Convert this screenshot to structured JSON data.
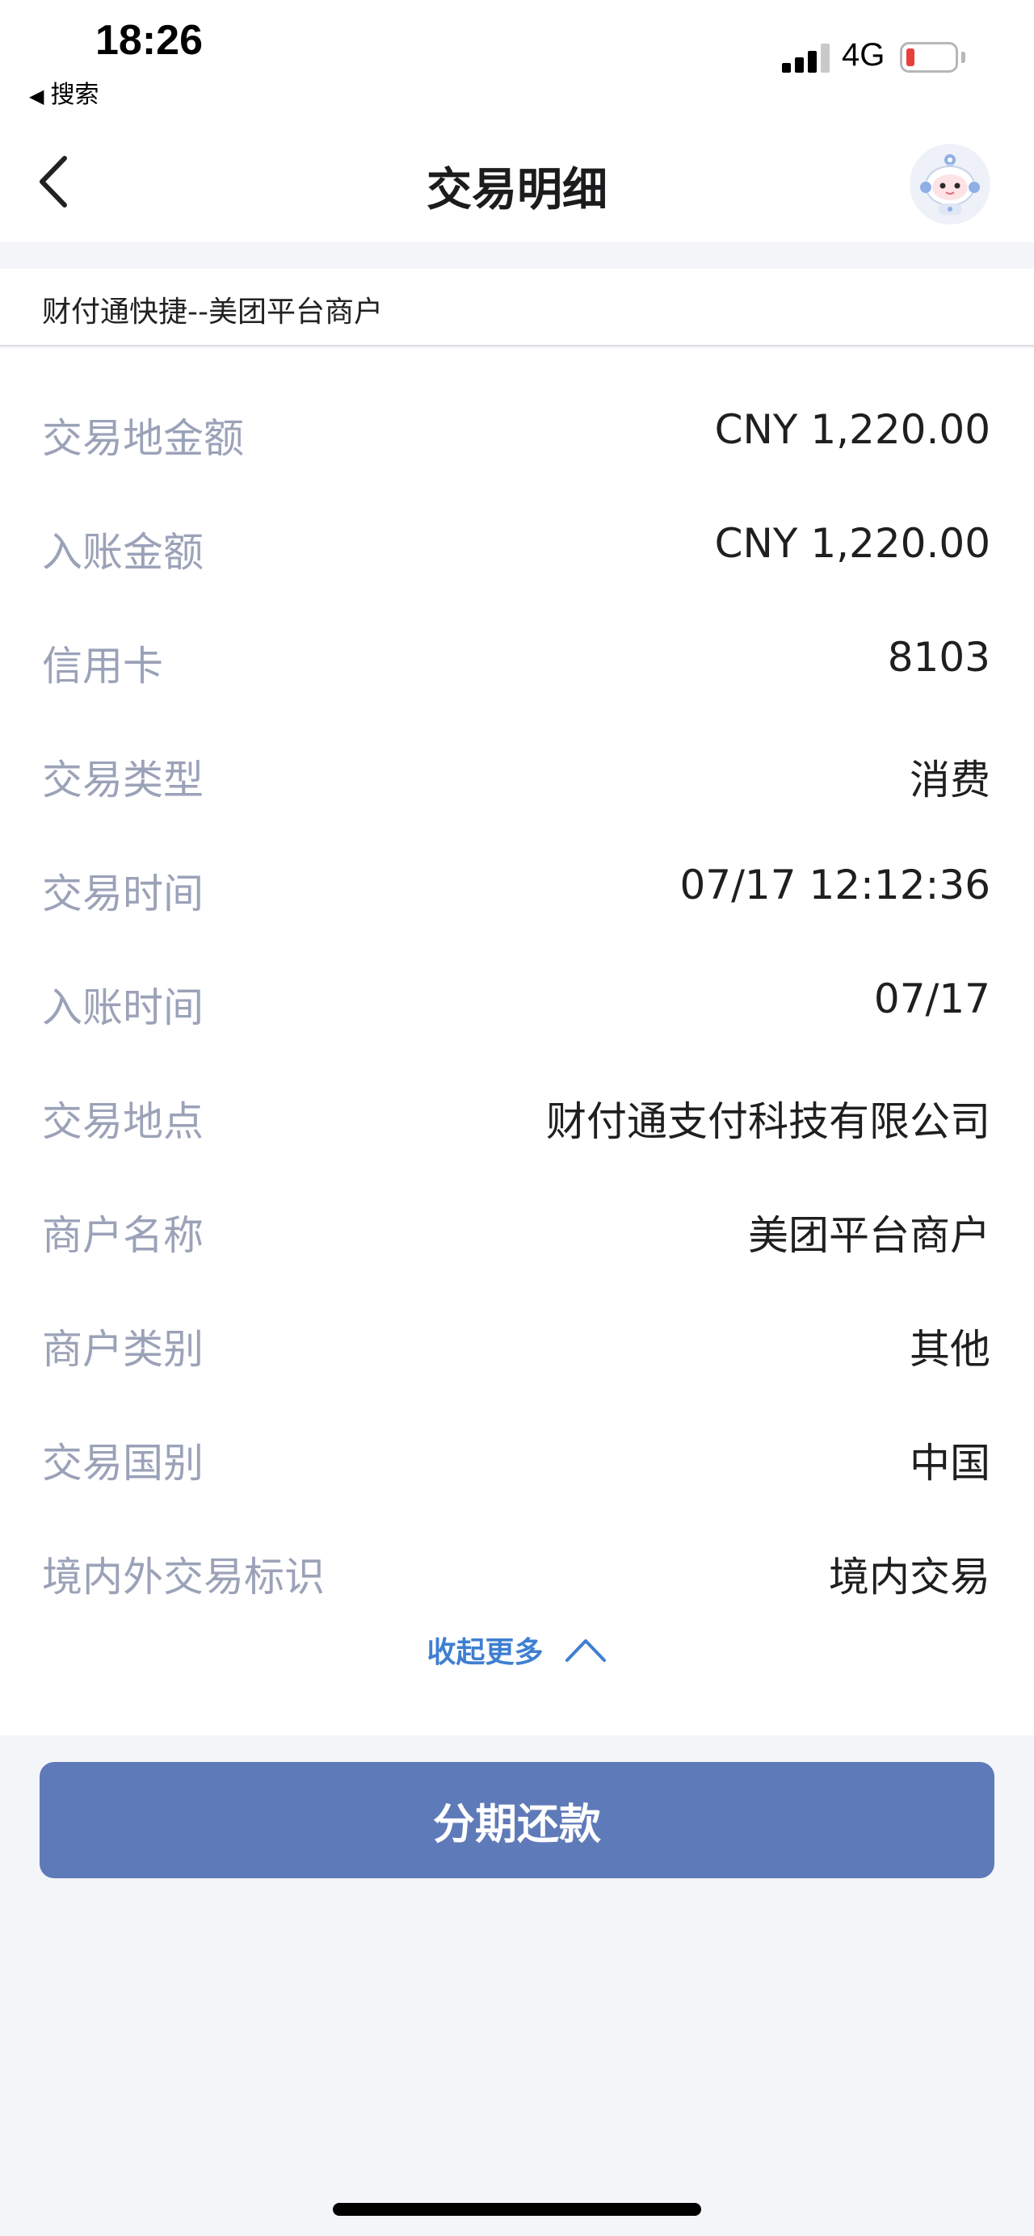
{
  "status_bar": {
    "time": "18:26",
    "back_app_label": "搜索",
    "network": "4G",
    "back_icon": "triangle-left-icon",
    "signal_icon": "cellular-signal-icon",
    "battery_icon": "battery-icon",
    "battery_level": 0.12,
    "signal_bars_active": 3,
    "signal_bars_total": 4
  },
  "nav": {
    "title": "交易明细",
    "back_icon": "chevron-left-icon",
    "avatar_icon": "robot-mascot-icon"
  },
  "merchant_header": "财付通快捷--美团平台商户",
  "details": [
    {
      "label": "交易地金额",
      "value": "CNY 1,220.00"
    },
    {
      "label": "入账金额",
      "value": "CNY 1,220.00"
    },
    {
      "label": "信用卡",
      "value": "8103"
    },
    {
      "label": "交易类型",
      "value": "消费"
    },
    {
      "label": "交易时间",
      "value": "07/17 12:12:36"
    },
    {
      "label": "入账时间",
      "value": "07/17"
    },
    {
      "label": "交易地点",
      "value": "财付通支付科技有限公司"
    },
    {
      "label": "商户名称",
      "value": "美团平台商户"
    },
    {
      "label": "商户类别",
      "value": "其他"
    },
    {
      "label": "交易国别",
      "value": "中国"
    },
    {
      "label": "境内外交易标识",
      "value": "境内交易"
    }
  ],
  "collapse": {
    "label": "收起更多",
    "icon": "chevron-up-icon"
  },
  "primary_button": "分期还款",
  "colors": {
    "accent_blue": "#3f7fd1",
    "button_bg": "#5f7ab8",
    "label_gray": "#9ba2b8",
    "battery_low": "#e8413c"
  }
}
